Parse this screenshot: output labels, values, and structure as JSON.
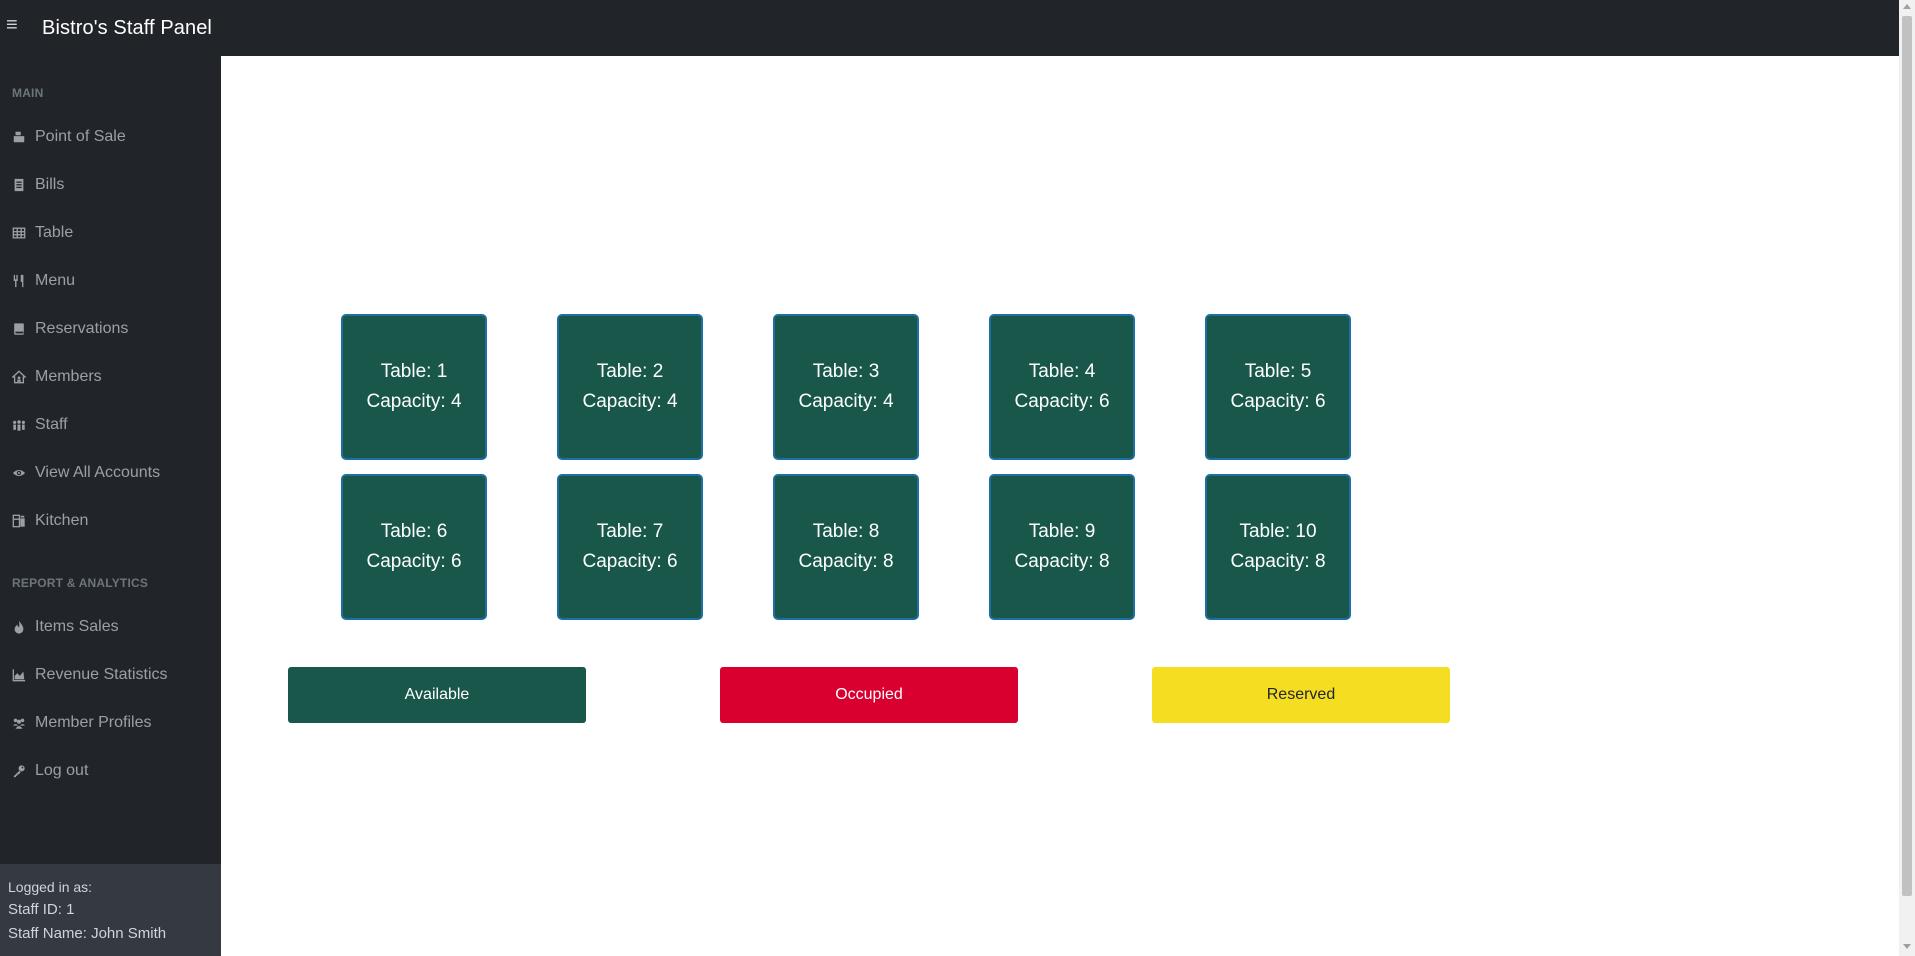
{
  "header": {
    "menu_icon": "≡",
    "title": "Bistro's Staff Panel"
  },
  "sidebar": {
    "main_heading": "MAIN",
    "main_items": [
      {
        "label": "Point of Sale",
        "icon": "cash-register-icon"
      },
      {
        "label": "Bills",
        "icon": "receipt-icon"
      },
      {
        "label": "Table",
        "icon": "table-icon"
      },
      {
        "label": "Menu",
        "icon": "utensils-icon"
      },
      {
        "label": "Reservations",
        "icon": "book-icon"
      },
      {
        "label": "Members",
        "icon": "house-user-icon"
      },
      {
        "label": "Staff",
        "icon": "people-group-icon"
      },
      {
        "label": "View All Accounts",
        "icon": "eye-icon"
      },
      {
        "label": "Kitchen",
        "icon": "kitchen-icon"
      }
    ],
    "report_heading": "REPORT & ANALYTICS",
    "report_items": [
      {
        "label": "Items Sales",
        "icon": "fire-icon"
      },
      {
        "label": "Revenue Statistics",
        "icon": "chart-area-icon"
      },
      {
        "label": "Member Profiles",
        "icon": "users-icon"
      },
      {
        "label": "Log out",
        "icon": "key-icon"
      }
    ]
  },
  "footer": {
    "logged_in_as": "Logged in as:",
    "staff_id": "Staff ID: 1",
    "staff_name": "Staff Name: John Smith"
  },
  "tables": [
    {
      "label": "Table: 1",
      "capacity": "Capacity: 4",
      "status": "available"
    },
    {
      "label": "Table: 2",
      "capacity": "Capacity: 4",
      "status": "available"
    },
    {
      "label": "Table: 3",
      "capacity": "Capacity: 4",
      "status": "available"
    },
    {
      "label": "Table: 4",
      "capacity": "Capacity: 6",
      "status": "available"
    },
    {
      "label": "Table: 5",
      "capacity": "Capacity: 6",
      "status": "available"
    },
    {
      "label": "Table: 6",
      "capacity": "Capacity: 6",
      "status": "available"
    },
    {
      "label": "Table: 7",
      "capacity": "Capacity: 6",
      "status": "available"
    },
    {
      "label": "Table: 8",
      "capacity": "Capacity: 8",
      "status": "available"
    },
    {
      "label": "Table: 9",
      "capacity": "Capacity: 8",
      "status": "available"
    },
    {
      "label": "Table: 10",
      "capacity": "Capacity: 8",
      "status": "available"
    }
  ],
  "legend": {
    "available": "Available",
    "occupied": "Occupied",
    "reserved": "Reserved"
  },
  "colors": {
    "available": "#18574a",
    "occupied": "#d90030",
    "reserved": "#f5de22",
    "sidebar_bg": "#212529"
  }
}
